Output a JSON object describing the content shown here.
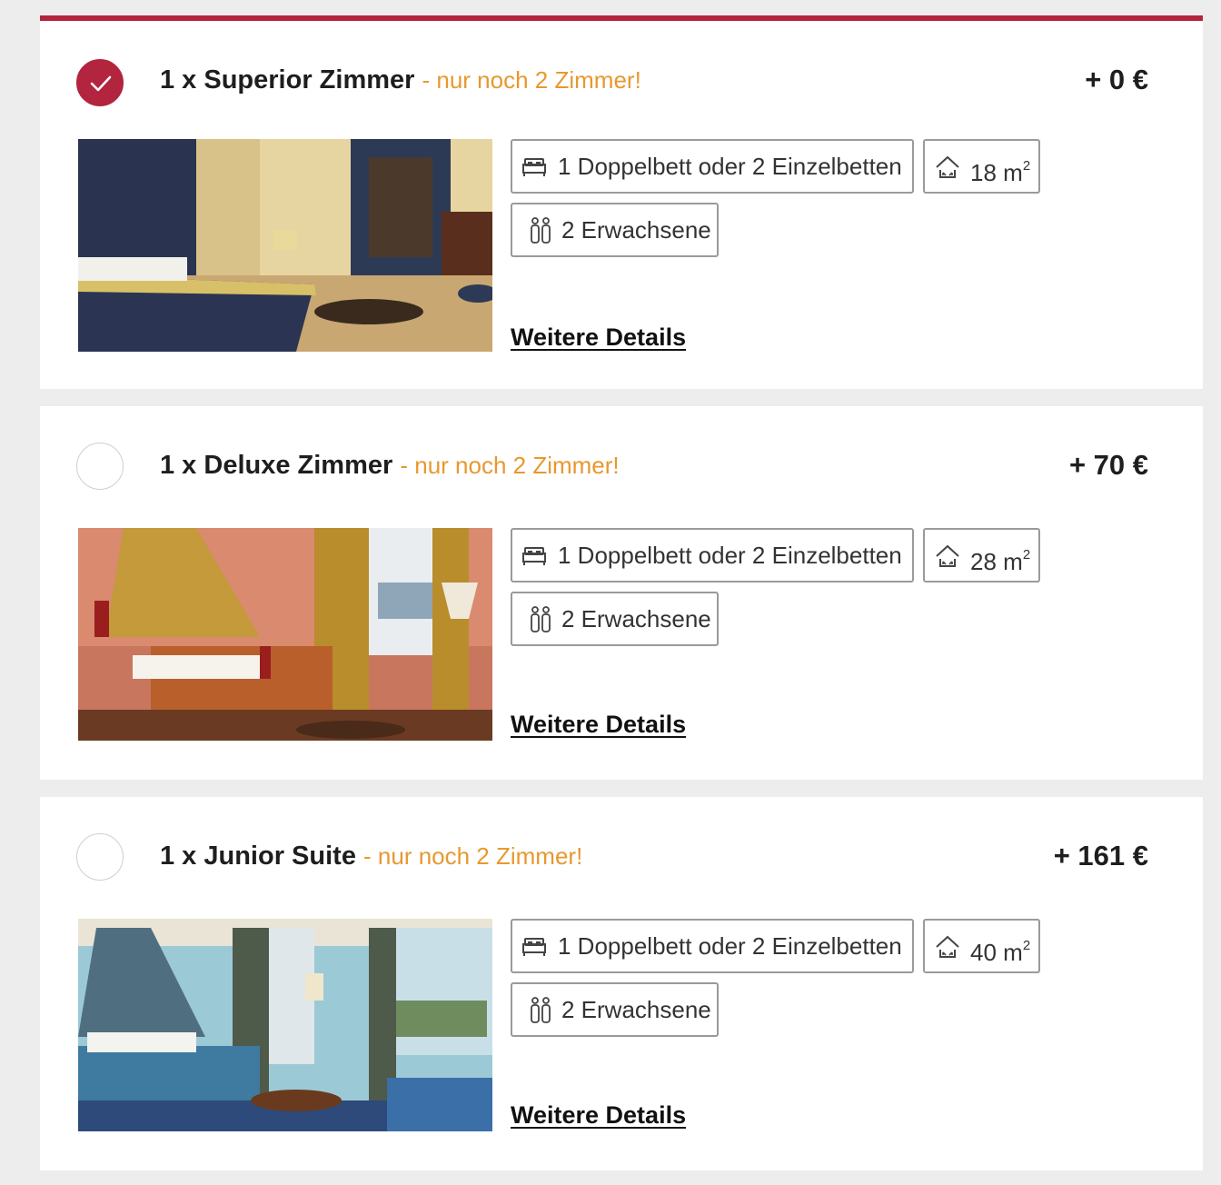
{
  "colors": {
    "accent": "#b3243e",
    "availability": "#e8982f",
    "background": "#ededed"
  },
  "rooms": [
    {
      "selected": true,
      "name": "1 x Superior Zimmer",
      "availability": "- nur noch 2 Zimmer!",
      "price": "+ 0 €",
      "beds": "1 Doppelbett oder 2 Einzelbetten",
      "size_value": "18 m",
      "size_unit_exp": "2",
      "guests": "2 Erwachsene",
      "details_link": "Weitere Details",
      "image_theme": "blue-gold classic bedroom"
    },
    {
      "selected": false,
      "name": "1 x Deluxe Zimmer",
      "availability": "- nur noch 2 Zimmer!",
      "price": "+ 70 €",
      "beds": "1 Doppelbett oder 2 Einzelbetten",
      "size_value": "28 m",
      "size_unit_exp": "2",
      "guests": "2 Erwachsene",
      "details_link": "Weitere Details",
      "image_theme": "terracotta bedroom with canopy"
    },
    {
      "selected": false,
      "name": "1 x Junior Suite",
      "availability": "- nur noch 2 Zimmer!",
      "price": "+ 161 €",
      "beds": "1 Doppelbett oder 2 Einzelbetten",
      "size_value": "40 m",
      "size_unit_exp": "2",
      "guests": "2 Erwachsene",
      "details_link": "Weitere Details",
      "image_theme": "light blue suite with lake view"
    }
  ]
}
